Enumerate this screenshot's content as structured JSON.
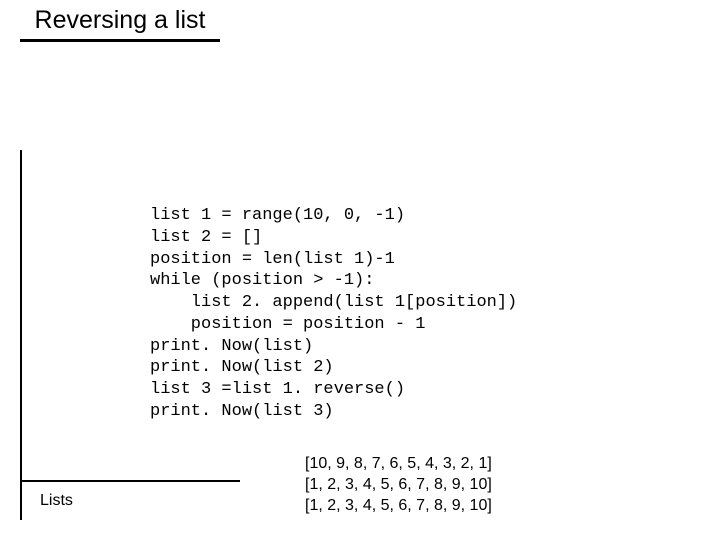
{
  "title": "Reversing a list",
  "code": "list 1 = range(10, 0, -1)\nlist 2 = []\nposition = len(list 1)-1\nwhile (position > -1):\n    list 2. append(list 1[position])\n    position = position - 1\nprint. Now(list)\nprint. Now(list 2)\nlist 3 =list 1. reverse()\nprint. Now(list 3)",
  "output": "[10, 9, 8, 7, 6, 5, 4, 3, 2, 1]\n[1, 2, 3, 4, 5, 6, 7, 8, 9, 10]\n[1, 2, 3, 4, 5, 6, 7, 8, 9, 10]",
  "footer": "Lists"
}
